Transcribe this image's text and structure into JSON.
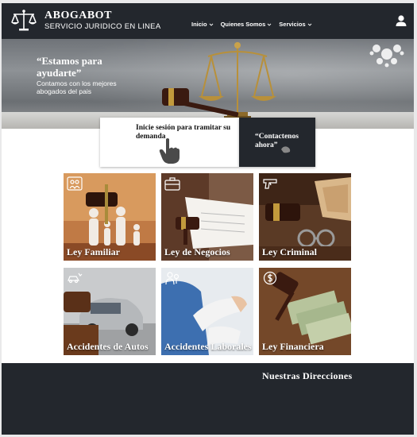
{
  "header": {
    "brand_title": "ABOGABOT",
    "brand_subtitle": "SERVICIO JURIDICO EN LINEA",
    "nav": [
      {
        "label": "Inicio",
        "icon": "chevron-down-icon"
      },
      {
        "label": "Quienes Somos",
        "icon": "chevron-down-icon"
      },
      {
        "label": "Servicios",
        "icon": "chevron-down-icon"
      }
    ],
    "user_icon": "user-icon",
    "logo_icon": "scales-logo-icon"
  },
  "hero": {
    "quote": "“Estamos para ayudarte”",
    "text": "Contamos con los mejores abogados del pais"
  },
  "cta": {
    "login_label": "Inicie sesión para tramitar su demanda",
    "contact_label": "“Contactenos ahora”"
  },
  "cards": [
    {
      "title": "Ley Familiar",
      "icon": "family-icon"
    },
    {
      "title": "Ley de Negocios",
      "icon": "briefcase-icon"
    },
    {
      "title": "Ley Criminal",
      "icon": "gun-icon"
    },
    {
      "title": "Accidentes de Autos",
      "icon": "car-crash-icon"
    },
    {
      "title": "Accidentes Laborales",
      "icon": "worker-icon"
    },
    {
      "title": "Ley Financiera",
      "icon": "money-icon"
    }
  ],
  "footer": {
    "title": "Nuestras Direcciones"
  },
  "colors": {
    "dark": "#23272d",
    "white": "#ffffff"
  }
}
